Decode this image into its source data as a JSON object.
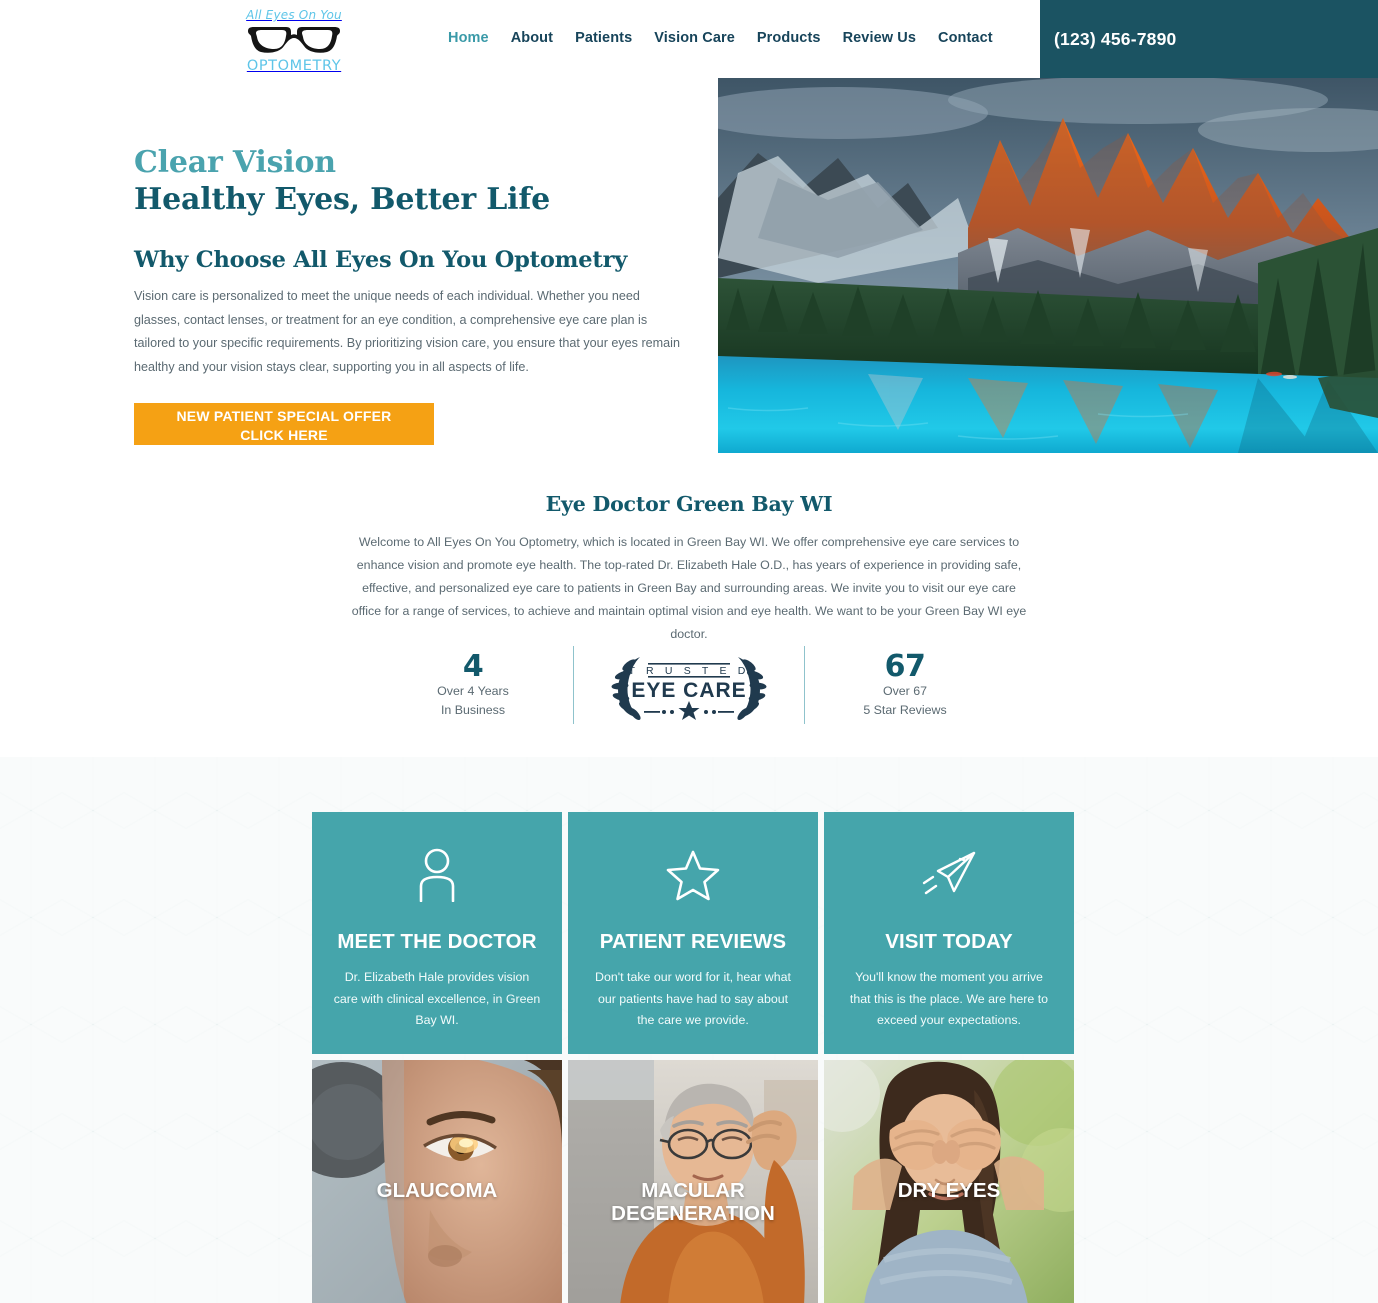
{
  "header": {
    "logo": {
      "top_text": "All Eyes On You",
      "bottom_text": "OPTOMETRY",
      "icon": "eyeglasses-icon",
      "color": "#5ec5e8"
    },
    "nav": [
      {
        "label": "Home",
        "active": true
      },
      {
        "label": "About",
        "active": false
      },
      {
        "label": "Patients",
        "active": false
      },
      {
        "label": "Vision Care",
        "active": false
      },
      {
        "label": "Products",
        "active": false
      },
      {
        "label": "Review Us",
        "active": false
      },
      {
        "label": "Contact",
        "active": false
      }
    ],
    "phone": "(123) 456-7890",
    "phone_block_color": "#1b5362"
  },
  "hero": {
    "eyebrow": "Clear Vision",
    "headline": "Healthy Eyes, Better Life",
    "subheading": "Why Choose All Eyes On You Optometry",
    "body": "Vision care is personalized to meet the unique needs of each individual. Whether you need glasses, contact lenses, or treatment for an eye condition, a comprehensive eye care plan is tailored to your specific requirements. By prioritizing vision care, you ensure that your eyes remain healthy and your vision stays clear, supporting you in all aspects of life.",
    "cta_line1": "NEW PATIENT SPECIAL OFFER",
    "cta_line2": "CLICK HERE",
    "cta_color": "#f5a114",
    "image_alt": "mountain-lake-photo"
  },
  "intro": {
    "title": "Eye Doctor Green Bay WI",
    "body": "Welcome to All Eyes On You Optometry, which is located in Green Bay WI. We offer comprehensive eye care services to enhance vision and promote eye health. The top-rated Dr. Elizabeth Hale O.D., has years of experience in providing safe, effective, and personalized eye care to patients in Green Bay and surrounding areas. We invite you to visit our eye care office for a range of services, to achieve and maintain optimal vision and eye health. We want to be your Green Bay WI eye doctor."
  },
  "stats": {
    "left": {
      "number": "4",
      "line1": "Over 4 Years",
      "line2": "In Business"
    },
    "badge": {
      "top_text": "T R U S T E D",
      "main_text": "EYE CARE",
      "icon": "trusted-eye-care-laurel-badge"
    },
    "right": {
      "number": "67",
      "line1": "Over 67",
      "line2": "5 Star Reviews"
    }
  },
  "cards": {
    "accent_color": "#45a5ab",
    "info": [
      {
        "icon": "person-icon",
        "title": "MEET THE DOCTOR",
        "body": "Dr. Elizabeth Hale provides vision care with clinical excellence, in Green Bay WI."
      },
      {
        "icon": "star-icon",
        "title": "PATIENT REVIEWS",
        "body": "Don't take our word for it, hear what our patients have had to say about the care we provide."
      },
      {
        "icon": "paper-plane-icon",
        "title": "VISIT TODAY",
        "body": "You'll know the moment you arrive that this is the place. We are here to exceed your expectations."
      }
    ],
    "conditions": [
      {
        "label": "GLAUCOMA",
        "image_alt": "woman-eye-exam-photo"
      },
      {
        "label": "MACULAR DEGENERATION",
        "image_alt": "older-man-glasses-photo"
      },
      {
        "label": "DRY EYES",
        "image_alt": "woman-rubbing-eyes-photo"
      }
    ]
  }
}
